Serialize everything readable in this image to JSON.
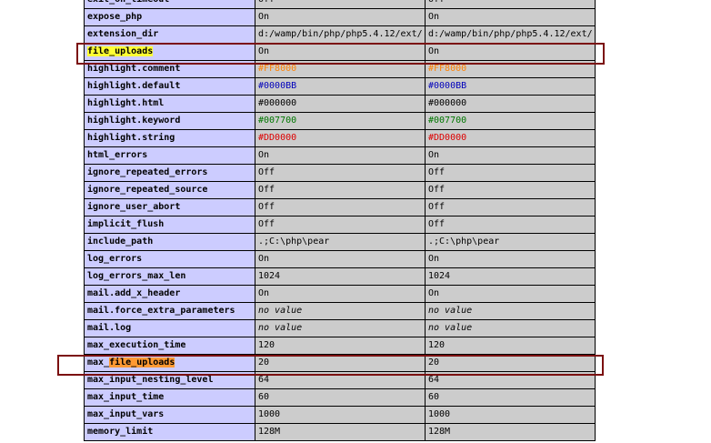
{
  "colors": {
    "directive_bg": "#ccccff",
    "value_bg": "#cccccc",
    "highlight_yellow": "#ffff33",
    "highlight_orange": "#ff9933",
    "callout_border": "#7b1010"
  },
  "rows": [
    {
      "directive": "exit_on_timeout",
      "local": "Off",
      "master": "Off"
    },
    {
      "directive": "expose_php",
      "local": "On",
      "master": "On"
    },
    {
      "directive": "extension_dir",
      "local": "d:/wamp/bin/php/php5.4.12/ext/",
      "master": "d:/wamp/bin/php/php5.4.12/ext/"
    },
    {
      "directive": "file_uploads",
      "local": "On",
      "master": "On"
    },
    {
      "directive": "highlight.comment",
      "local": "#FF8000",
      "master": "#FF8000",
      "color": "#FF8000"
    },
    {
      "directive": "highlight.default",
      "local": "#0000BB",
      "master": "#0000BB",
      "color": "#0000BB"
    },
    {
      "directive": "highlight.html",
      "local": "#000000",
      "master": "#000000",
      "color": "#000000"
    },
    {
      "directive": "highlight.keyword",
      "local": "#007700",
      "master": "#007700",
      "color": "#007700"
    },
    {
      "directive": "highlight.string",
      "local": "#DD0000",
      "master": "#DD0000",
      "color": "#DD0000"
    },
    {
      "directive": "html_errors",
      "local": "On",
      "master": "On"
    },
    {
      "directive": "ignore_repeated_errors",
      "local": "Off",
      "master": "Off"
    },
    {
      "directive": "ignore_repeated_source",
      "local": "Off",
      "master": "Off"
    },
    {
      "directive": "ignore_user_abort",
      "local": "Off",
      "master": "Off"
    },
    {
      "directive": "implicit_flush",
      "local": "Off",
      "master": "Off"
    },
    {
      "directive": "include_path",
      "local": ".;C:\\php\\pear",
      "master": ".;C:\\php\\pear"
    },
    {
      "directive": "log_errors",
      "local": "On",
      "master": "On"
    },
    {
      "directive": "log_errors_max_len",
      "local": "1024",
      "master": "1024"
    },
    {
      "directive": "mail.add_x_header",
      "local": "On",
      "master": "On"
    },
    {
      "directive": "mail.force_extra_parameters",
      "local": "no value",
      "master": "no value",
      "no_value": true
    },
    {
      "directive": "mail.log",
      "local": "no value",
      "master": "no value",
      "no_value": true
    },
    {
      "directive": "max_execution_time",
      "local": "120",
      "master": "120"
    },
    {
      "directive": "max_file_uploads",
      "local": "20",
      "master": "20"
    },
    {
      "directive": "max_input_nesting_level",
      "local": "64",
      "master": "64"
    },
    {
      "directive": "max_input_time",
      "local": "60",
      "master": "60"
    },
    {
      "directive": "max_input_vars",
      "local": "1000",
      "master": "1000"
    },
    {
      "directive": "memory_limit",
      "local": "128M",
      "master": "128M"
    }
  ]
}
